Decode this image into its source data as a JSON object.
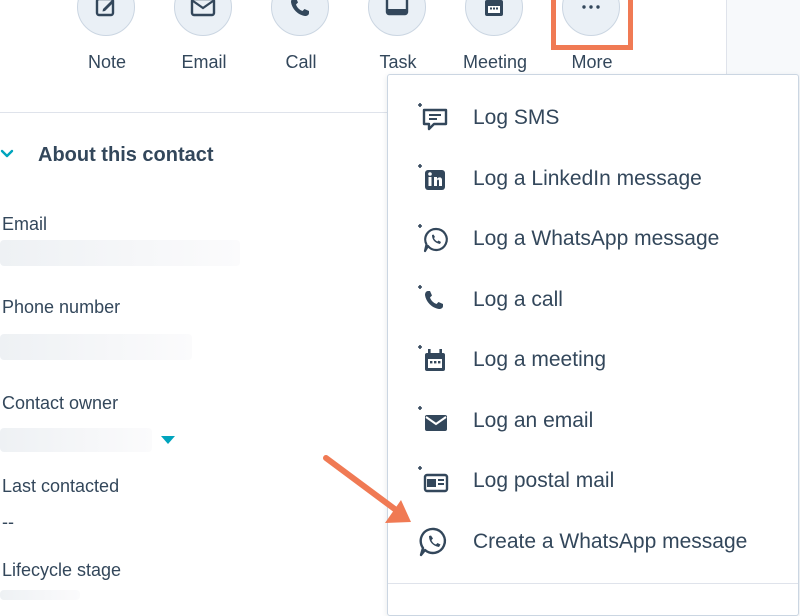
{
  "actions": [
    {
      "label": "Note",
      "icon": "note-icon"
    },
    {
      "label": "Email",
      "icon": "email-icon"
    },
    {
      "label": "Call",
      "icon": "call-icon"
    },
    {
      "label": "Task",
      "icon": "task-icon"
    },
    {
      "label": "Meeting",
      "icon": "meeting-icon"
    },
    {
      "label": "More",
      "icon": "ellipsis-icon"
    }
  ],
  "about": {
    "title": "About this contact",
    "fields": [
      {
        "label": "Email",
        "value": ""
      },
      {
        "label": "Phone number",
        "value": ""
      },
      {
        "label": "Contact owner",
        "value": ""
      },
      {
        "label": "Last contacted",
        "value": "--"
      },
      {
        "label": "Lifecycle stage",
        "value": ""
      }
    ]
  },
  "menu": {
    "items": [
      {
        "label": "Log SMS",
        "icon": "log-sms-icon"
      },
      {
        "label": "Log a LinkedIn message",
        "icon": "log-linkedin-icon"
      },
      {
        "label": "Log a WhatsApp message",
        "icon": "log-whatsapp-icon"
      },
      {
        "label": "Log a call",
        "icon": "log-call-icon"
      },
      {
        "label": "Log a meeting",
        "icon": "log-meeting-icon"
      },
      {
        "label": "Log an email",
        "icon": "log-email-icon"
      },
      {
        "label": "Log postal mail",
        "icon": "log-postal-mail-icon"
      },
      {
        "label": "Create a WhatsApp message",
        "icon": "whatsapp-icon"
      }
    ]
  },
  "colors": {
    "text": "#33475b",
    "accent": "#00a4bd",
    "highlight": "#f07a54",
    "circle_bg": "#eaf0f6",
    "border": "#cbd6e2"
  }
}
